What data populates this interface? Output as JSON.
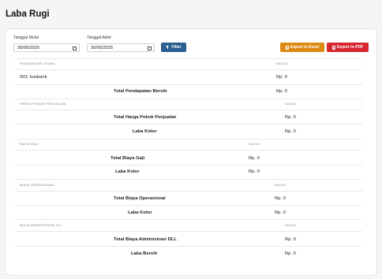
{
  "page": {
    "title": "Laba Rugi"
  },
  "filters": {
    "start_label": "Tanggal Mulai",
    "start_value": "30/05/2025",
    "end_label": "Tanggal Akhir",
    "end_value": "30/05/2025",
    "filter_button": "Filter",
    "excel_button": "Export to Excel",
    "pdf_button": "Export to PDF"
  },
  "colors": {
    "filter": "#2c5f8f",
    "excel": "#dd8a12",
    "pdf": "#d7262e"
  },
  "sections": {
    "pendapatan": {
      "header": "PENDAPATAN USAHA",
      "saldo": "SALDO",
      "item_name": "003. kasbank",
      "item_value": "Rp. 0",
      "total_label": "Total Pendapatan Bersih",
      "total_value": "Rp. 0"
    },
    "hpp": {
      "header": "HARGA POKOK PENJUALAN",
      "saldo": "SALDO",
      "total_label": "Total Harga Pokok Penjualan",
      "total_value": "Rp. 0",
      "laba_label": "Laba Kotor",
      "laba_value": "Rp. 0"
    },
    "gaji": {
      "header": "BIAYA GAJI",
      "saldo": "SALDO",
      "total_label": "Total Biaya Gaji",
      "total_value": "Rp. 0",
      "laba_label": "Laba Kotor",
      "laba_value": "Rp. 0"
    },
    "operasional": {
      "header": "BIAYA OPERASIONAL",
      "saldo": "SALDO",
      "total_label": "Total Biaya Operasional",
      "total_value": "Rp. 0",
      "laba_label": "Laba Kotor",
      "laba_value": "Rp. 0"
    },
    "administrasi": {
      "header": "BIAYA ADMINISTRASI DLL",
      "saldo": "SALDO",
      "total_label": "Total Biaya Administrasi DLL",
      "total_value": "Rp. 0",
      "laba_label": "Laba Bersih",
      "laba_value": "Rp. 0"
    }
  }
}
